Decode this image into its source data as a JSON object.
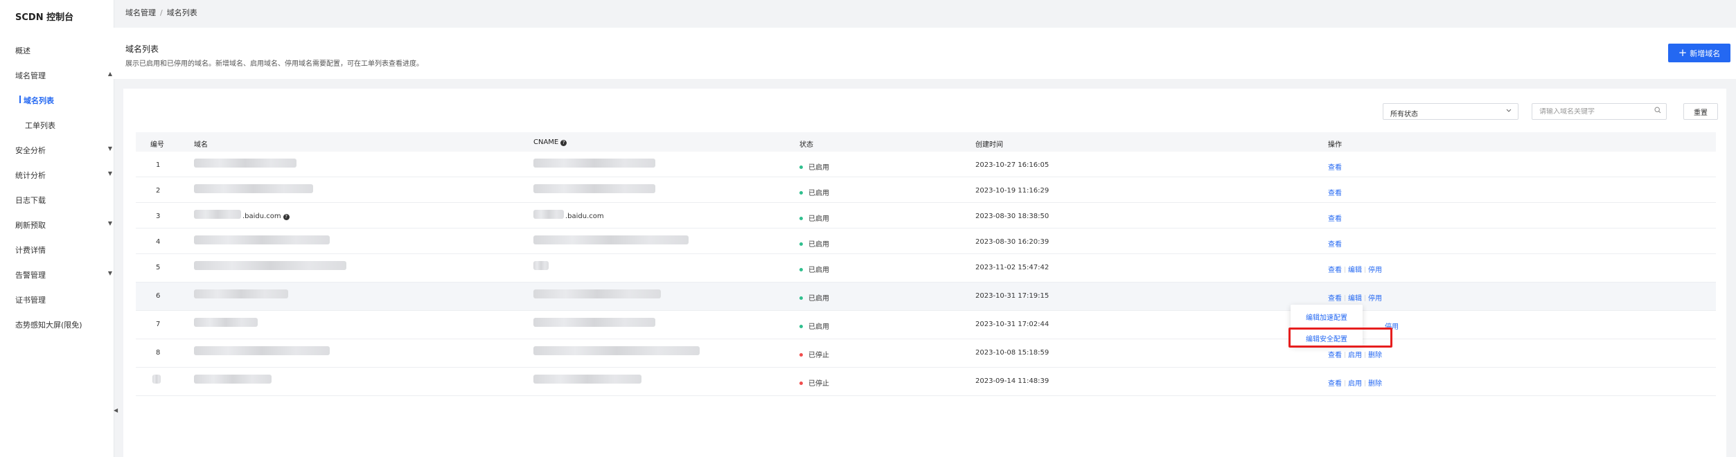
{
  "sidebar": {
    "brand": "SCDN 控制台",
    "items": [
      {
        "label": "概述"
      },
      {
        "label": "域名管理",
        "caret": "▲"
      },
      {
        "label": "域名列表"
      },
      {
        "label": "工单列表"
      },
      {
        "label": "安全分析",
        "caret": "▼"
      },
      {
        "label": "统计分析",
        "caret": "▼"
      },
      {
        "label": "日志下载"
      },
      {
        "label": "刷新预取",
        "caret": "▼"
      },
      {
        "label": "计费详情"
      },
      {
        "label": "告警管理",
        "caret": "▼"
      },
      {
        "label": "证书管理"
      },
      {
        "label": "态势感知大屏(限免)"
      }
    ],
    "collapse_glyph": "◀"
  },
  "breadcrumb": {
    "parent": "域名管理",
    "separator": "/",
    "current": "域名列表"
  },
  "header": {
    "title": "域名列表",
    "description": "展示已启用和已停用的域名。新增域名、启用域名、停用域名需要配置，可在工单列表查看进度。",
    "add_button": "新增域名",
    "add_icon": "+"
  },
  "filters": {
    "status_value": "所有状态",
    "search_placeholder": "请输入域名关键字",
    "reset_label": "重置"
  },
  "table": {
    "columns": {
      "no": "编号",
      "domain": "域名",
      "cname": "CNAME",
      "status": "状态",
      "created": "创建时间",
      "ops": "操作"
    },
    "rows": [
      {
        "no": "1",
        "domain": "",
        "cname": "",
        "status": "已启用",
        "created": "2023-10-27 16:16:05",
        "ops": [
          "查看"
        ]
      },
      {
        "no": "2",
        "domain": "",
        "cname": "",
        "status": "已启用",
        "created": "2023-10-19 11:16:29",
        "ops": [
          "查看"
        ]
      },
      {
        "no": "3",
        "domain": ".baidu.com",
        "cname": ".baidu.com",
        "status": "已启用",
        "created": "2023-08-30 18:38:50",
        "ops": [
          "查看"
        ]
      },
      {
        "no": "4",
        "domain": "",
        "cname": "",
        "status": "已启用",
        "created": "2023-08-30 16:20:39",
        "ops": [
          "查看"
        ]
      },
      {
        "no": "5",
        "domain": "",
        "cname": "",
        "status": "已启用",
        "created": "2023-11-02 15:47:42",
        "ops": [
          "查看",
          "编辑",
          "停用"
        ]
      },
      {
        "no": "6",
        "domain": "",
        "cname": "",
        "status": "已启用",
        "created": "2023-10-31 17:19:15",
        "ops": [
          "查看",
          "编辑",
          "停用"
        ]
      },
      {
        "no": "7",
        "domain": "",
        "cname": "",
        "status": "已启用",
        "created": "2023-10-31 17:02:44",
        "ops": [
          "停用"
        ]
      },
      {
        "no": "8",
        "domain": "",
        "cname": "",
        "status": "已停止",
        "created": "2023-10-08 15:18:59",
        "ops": [
          "查看",
          "启用",
          "删除"
        ]
      },
      {
        "no": "",
        "domain": "",
        "cname": "",
        "status": "已停止",
        "created": "2023-09-14 11:48:39",
        "ops": [
          "查看",
          "启用",
          "删除"
        ]
      }
    ]
  },
  "dropdown": {
    "items": [
      "编辑加速配置",
      "编辑安全配置"
    ]
  },
  "colors": {
    "accent": "#2468f2",
    "enabled": "#30bf8e",
    "stopped": "#f04d4d",
    "highlight": "#e61e1e"
  }
}
